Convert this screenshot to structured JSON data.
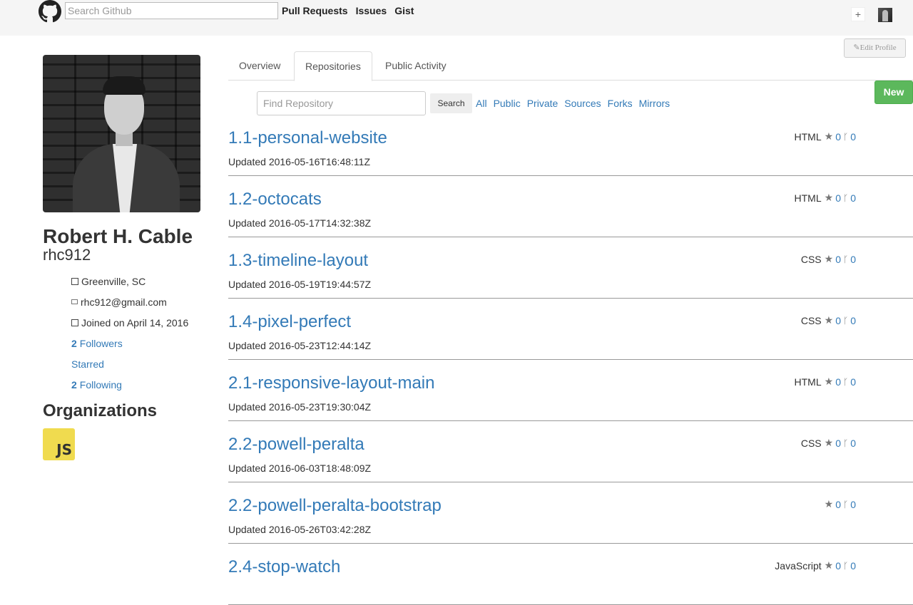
{
  "topbar": {
    "search_placeholder": "Search Github",
    "nav": [
      "Pull Requests",
      "Issues",
      "Gist"
    ],
    "plus": "+"
  },
  "edit_profile": "Edit Profile",
  "profile": {
    "full_name": "Robert H. Cable",
    "username": "rhc912",
    "location": "Greenville, SC",
    "email": "rhc912@gmail.com",
    "joined": "Joined on April 14, 2016",
    "followers_count": "2",
    "followers_label": "Followers",
    "starred_label": "Starred",
    "following_count": "2",
    "following_label": "Following",
    "organizations_title": "Organizations",
    "org_logo_text": "JS"
  },
  "tabs": [
    "Overview",
    "Repositories",
    "Public Activity"
  ],
  "filter": {
    "find_placeholder": "Find Repository",
    "search_label": "Search",
    "links": [
      "All",
      "Public",
      "Private",
      "Sources",
      "Forks",
      "Mirrors"
    ],
    "new_label": "New"
  },
  "repos": [
    {
      "name": "1.1-personal-website",
      "updated": "Updated 2016-05-16T16:48:11Z",
      "language": "HTML",
      "stars": "0",
      "forks": "0"
    },
    {
      "name": "1.2-octocats",
      "updated": "Updated 2016-05-17T14:32:38Z",
      "language": "HTML",
      "stars": "0",
      "forks": "0"
    },
    {
      "name": "1.3-timeline-layout",
      "updated": "Updated 2016-05-19T19:44:57Z",
      "language": "CSS",
      "stars": "0",
      "forks": "0"
    },
    {
      "name": "1.4-pixel-perfect",
      "updated": "Updated 2016-05-23T12:44:14Z",
      "language": "CSS",
      "stars": "0",
      "forks": "0"
    },
    {
      "name": "2.1-responsive-layout-main",
      "updated": "Updated 2016-05-23T19:30:04Z",
      "language": "HTML",
      "stars": "0",
      "forks": "0"
    },
    {
      "name": "2.2-powell-peralta",
      "updated": "Updated 2016-06-03T18:48:09Z",
      "language": "CSS",
      "stars": "0",
      "forks": "0"
    },
    {
      "name": "2.2-powell-peralta-bootstrap",
      "updated": "Updated 2016-05-26T03:42:28Z",
      "language": "",
      "stars": "0",
      "forks": "0"
    },
    {
      "name": "2.4-stop-watch",
      "updated": "",
      "language": "JavaScript",
      "stars": "0",
      "forks": "0"
    }
  ],
  "colors": {
    "link": "#337ab7",
    "new_button": "#5cb85c",
    "js_logo": "#f0db4f"
  }
}
